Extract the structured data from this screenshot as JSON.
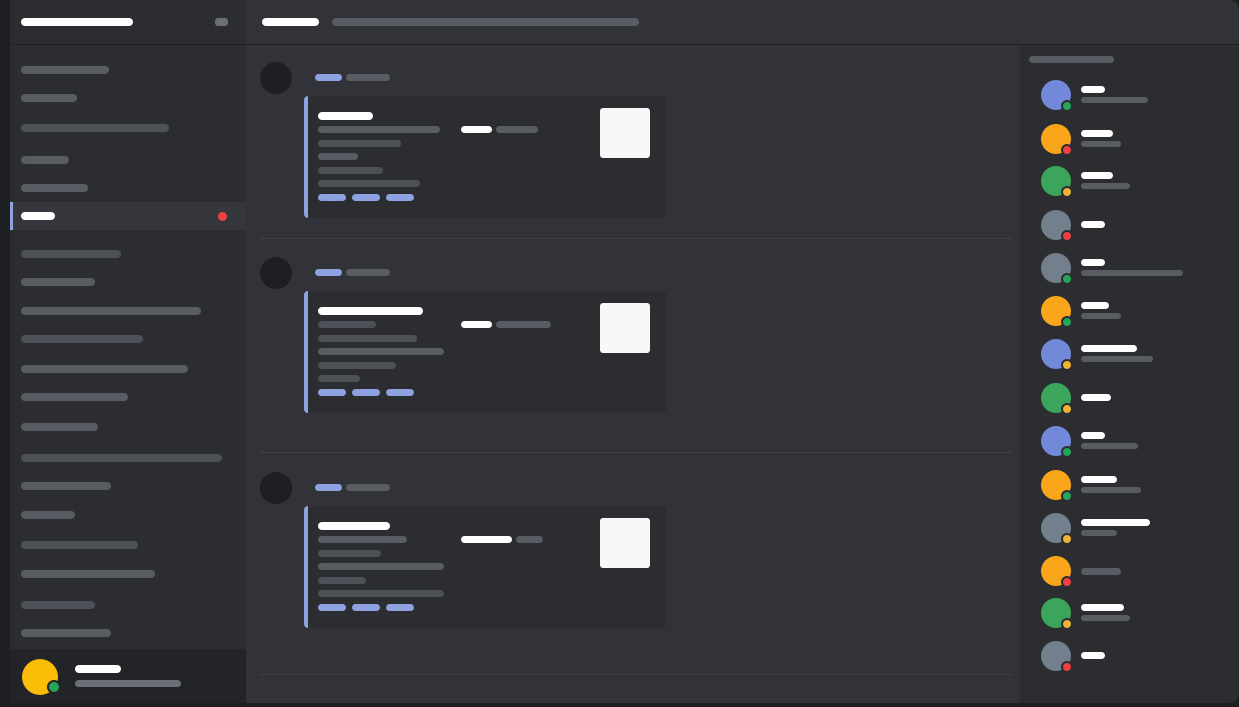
{
  "colors": {
    "accent": "#8ea1e1",
    "status_online": "#23a55a",
    "status_idle": "#f0b232",
    "status_dnd": "#f23f43",
    "avatar_blurple": "#7289da",
    "avatar_orange": "#faa61a",
    "avatar_green": "#3ba55c",
    "avatar_gray": "#747f8d",
    "user_avatar": "#fbbd08"
  },
  "sidebar": {
    "channels": [
      {
        "active": false,
        "unread": false
      },
      {
        "active": false,
        "unread": false
      },
      {
        "active": false,
        "unread": false
      },
      {
        "active": false,
        "unread": false
      },
      {
        "active": false,
        "unread": false
      },
      {
        "active": true,
        "unread": true
      },
      {
        "active": false,
        "unread": false
      },
      {
        "active": false,
        "unread": false
      },
      {
        "active": false,
        "unread": false
      },
      {
        "active": false,
        "unread": false
      },
      {
        "active": false,
        "unread": false
      },
      {
        "active": false,
        "unread": false
      },
      {
        "active": false,
        "unread": false
      },
      {
        "active": false,
        "unread": false
      },
      {
        "active": false,
        "unread": false
      },
      {
        "active": false,
        "unread": false
      },
      {
        "active": false,
        "unread": false
      },
      {
        "active": false,
        "unread": false
      },
      {
        "active": false,
        "unread": false
      },
      {
        "active": false,
        "unread": false
      }
    ]
  },
  "user_panel": {
    "avatar_color": "#fbbd08",
    "status": "online"
  },
  "messages": [
    {
      "has_embed": true,
      "embed_tags": 3
    },
    {
      "has_embed": true,
      "embed_tags": 3
    },
    {
      "has_embed": true,
      "embed_tags": 3
    }
  ],
  "members": [
    {
      "avatar_color": "#7289da",
      "status": "online"
    },
    {
      "avatar_color": "#faa61a",
      "status": "dnd"
    },
    {
      "avatar_color": "#3ba55c",
      "status": "idle"
    },
    {
      "avatar_color": "#747f8d",
      "status": "dnd"
    },
    {
      "avatar_color": "#747f8d",
      "status": "online"
    },
    {
      "avatar_color": "#faa61a",
      "status": "online"
    },
    {
      "avatar_color": "#7289da",
      "status": "idle"
    },
    {
      "avatar_color": "#3ba55c",
      "status": "idle"
    },
    {
      "avatar_color": "#7289da",
      "status": "online"
    },
    {
      "avatar_color": "#faa61a",
      "status": "online"
    },
    {
      "avatar_color": "#747f8d",
      "status": "idle"
    },
    {
      "avatar_color": "#faa61a",
      "status": "dnd"
    },
    {
      "avatar_color": "#3ba55c",
      "status": "idle"
    },
    {
      "avatar_color": "#747f8d",
      "status": "dnd"
    }
  ]
}
